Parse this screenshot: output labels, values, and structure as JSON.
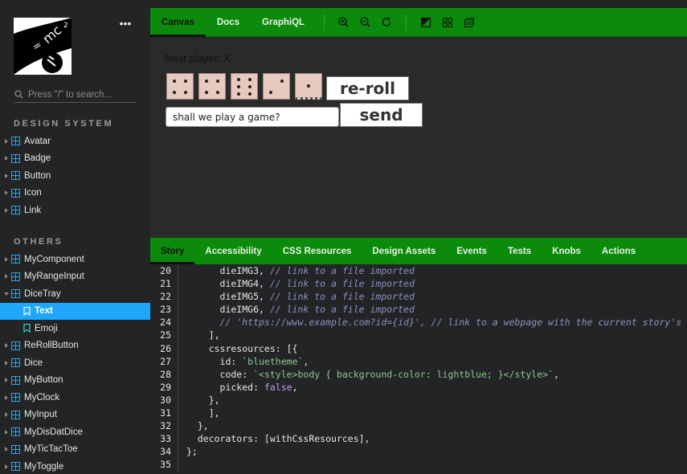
{
  "sidebar": {
    "search_placeholder": "Press \"/\" to search...",
    "more_label": "•••",
    "sections": {
      "design_system": "DESIGN SYSTEM",
      "others": "OTHERS"
    },
    "design_items": [
      "Avatar",
      "Badge",
      "Button",
      "Icon",
      "Link"
    ],
    "other_items": {
      "mycomponent": "MyComponent",
      "myrangeinput": "MyRangeInput",
      "dicetray": "DiceTray",
      "dicetray_text": "Text",
      "dicetray_emoji": "Emoji",
      "rerollbutton": "ReRollButton",
      "dice": "Dice",
      "mybutton": "MyButton",
      "myclock": "MyClock",
      "myinput": "MyInput",
      "mydisdatdice": "MyDisDatDice",
      "mytictactoe": "MyTicTacToe",
      "mytoggle": "MyToggle"
    }
  },
  "toolbar": {
    "tabs": [
      "Canvas",
      "Docs",
      "GraphiQL"
    ],
    "icons": [
      "zoom-in-icon",
      "zoom-out-icon",
      "zoom-reset-icon",
      "background-icon",
      "grid-icon",
      "outline-icon"
    ]
  },
  "preview": {
    "next_player": "Next player: X",
    "reroll_label": "re-roll",
    "send_label": "send",
    "chat_value": "shall we play a game?"
  },
  "panel": {
    "tabs": [
      "Story",
      "Accessibility",
      "CSS Resources",
      "Design Assets",
      "Events",
      "Tests",
      "Knobs",
      "Actions"
    ]
  },
  "code": {
    "lines": [
      {
        "n": "20",
        "code": "      dieIMG3, ",
        "comment": "// link to a file imported"
      },
      {
        "n": "21",
        "code": "      dieIMG4, ",
        "comment": "// link to a file imported"
      },
      {
        "n": "22",
        "code": "      dieIMG5, ",
        "comment": "// link to a file imported"
      },
      {
        "n": "23",
        "code": "      dieIMG6, ",
        "comment": "// link to a file imported"
      },
      {
        "n": "24",
        "code": "      ",
        "comment": "// 'https://www.example.com?id={id}', // link to a webpage with the current story's"
      },
      {
        "n": "25",
        "code": "    ],",
        "comment": ""
      },
      {
        "n": "26",
        "code": "    cssresources: [{",
        "comment": ""
      },
      {
        "n": "27",
        "code": "      id: ",
        "str": "`bluetheme`",
        "tail": ","
      },
      {
        "n": "28",
        "code": "      code: ",
        "str": "`<style>body { background-color: lightblue; }</style>`",
        "tail": ","
      },
      {
        "n": "29",
        "code": "      picked: ",
        "kw": "false",
        "tail": ","
      },
      {
        "n": "30",
        "code": "    },",
        "comment": ""
      },
      {
        "n": "31",
        "code": "    ],",
        "comment": ""
      },
      {
        "n": "32",
        "code": "  },",
        "comment": ""
      },
      {
        "n": "33",
        "code": "  decorators: [withCssResources],",
        "comment": ""
      },
      {
        "n": "34",
        "code": "};",
        "comment": ""
      },
      {
        "n": "35",
        "code": "",
        "comment": ""
      }
    ]
  },
  "colors": {
    "accent": "#0b8a0b",
    "selected": "#1ea7fd",
    "background": "#222425",
    "preview_bg": "#2a2a2a"
  }
}
